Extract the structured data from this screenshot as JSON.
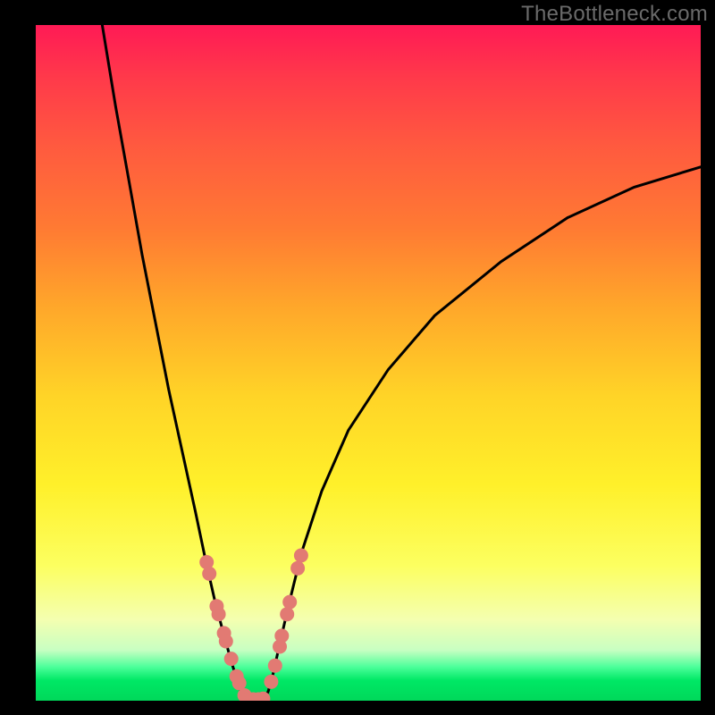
{
  "watermark": {
    "text": "TheBottleneck.com"
  },
  "colors": {
    "frame": "#000000",
    "curve": "#000000",
    "marker": "#e27a73",
    "gradient_stops": [
      "#ff1a55",
      "#ff3a4a",
      "#ff5a3f",
      "#ff7a33",
      "#ffa82a",
      "#ffd427",
      "#fff02a",
      "#fcff60",
      "#f4ffb0",
      "#c8ffc2",
      "#4cff9a",
      "#00e865",
      "#00d85a"
    ]
  },
  "chart_data": {
    "type": "line",
    "title": "",
    "xlabel": "",
    "ylabel": "",
    "xlim": [
      0,
      100
    ],
    "ylim": [
      0,
      100
    ],
    "grid": false,
    "legend": false,
    "series": [
      {
        "name": "left-branch",
        "x": [
          10,
          12,
          14,
          16,
          18,
          20,
          22,
          24,
          25.5,
          27,
          28.5,
          29.5,
          30.3,
          30.8,
          31.3
        ],
        "values": [
          100,
          88,
          77,
          66,
          56,
          46,
          37,
          28,
          21,
          14.5,
          9,
          5.5,
          3,
          1.5,
          0.2
        ]
      },
      {
        "name": "right-branch",
        "x": [
          34.5,
          35,
          35.7,
          36.6,
          38,
          40,
          43,
          47,
          53,
          60,
          70,
          80,
          90,
          100
        ],
        "values": [
          0.2,
          1.5,
          4,
          8,
          14,
          22,
          31,
          40,
          49,
          57,
          65,
          71.5,
          76,
          79
        ]
      }
    ],
    "markers": {
      "name": "highlight-dots",
      "color": "#e27a73",
      "points": [
        {
          "x": 25.7,
          "y": 20.5
        },
        {
          "x": 26.1,
          "y": 18.8
        },
        {
          "x": 27.2,
          "y": 14.0
        },
        {
          "x": 27.5,
          "y": 12.8
        },
        {
          "x": 28.3,
          "y": 10.0
        },
        {
          "x": 28.6,
          "y": 8.8
        },
        {
          "x": 29.4,
          "y": 6.2
        },
        {
          "x": 30.2,
          "y": 3.6
        },
        {
          "x": 30.6,
          "y": 2.6
        },
        {
          "x": 31.4,
          "y": 0.8
        },
        {
          "x": 31.9,
          "y": 0.2
        },
        {
          "x": 32.7,
          "y": 0.2
        },
        {
          "x": 33.5,
          "y": 0.2
        },
        {
          "x": 34.2,
          "y": 0.3
        },
        {
          "x": 35.4,
          "y": 2.8
        },
        {
          "x": 36.0,
          "y": 5.2
        },
        {
          "x": 36.7,
          "y": 8.0
        },
        {
          "x": 37.0,
          "y": 9.6
        },
        {
          "x": 37.8,
          "y": 12.8
        },
        {
          "x": 38.2,
          "y": 14.6
        },
        {
          "x": 39.4,
          "y": 19.6
        },
        {
          "x": 39.9,
          "y": 21.5
        }
      ]
    }
  }
}
